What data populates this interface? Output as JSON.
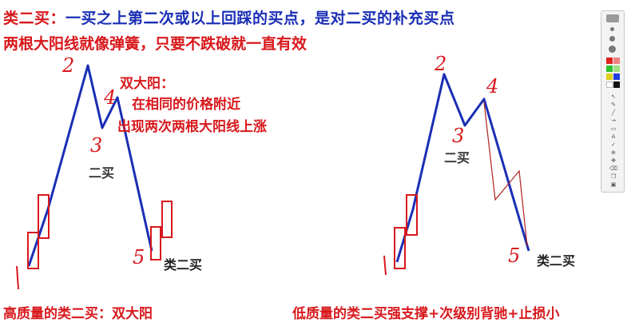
{
  "header": {
    "line1_red": "类二买：",
    "line1_blue": "一买之上第二次或以上回踩的买点，是对二买的补充买点",
    "line2": "两根大阳线就像弹簧，只要不跌破就一直有效"
  },
  "left_chart": {
    "note_title": "双大阳：",
    "note_line1": "在相同的价格附近",
    "note_line2": "出现两次两根大阳线上涨",
    "label_2nd_buy": "二买",
    "label_class2_buy": "类二买",
    "points": [
      "1",
      "2",
      "3",
      "4",
      "5"
    ]
  },
  "right_chart": {
    "label_2nd_buy": "二买",
    "label_class2_buy": "类二买",
    "points": [
      "1",
      "2",
      "3",
      "4",
      "5"
    ]
  },
  "captions": {
    "left": "高质量的类二买：双大阳",
    "right": "低质量的类二买强支撑+次级别背驰+止损小"
  },
  "colors": {
    "red": "#d8181c",
    "blue": "#1a2fb5"
  },
  "toolbar": {
    "icons": [
      "logo-icon",
      "pen-size-icon",
      "color-swatch-icon",
      "line-tool-icon",
      "arrow-tool-icon",
      "text-tool-icon",
      "eraser-icon",
      "copy-icon",
      "save-icon"
    ]
  }
}
